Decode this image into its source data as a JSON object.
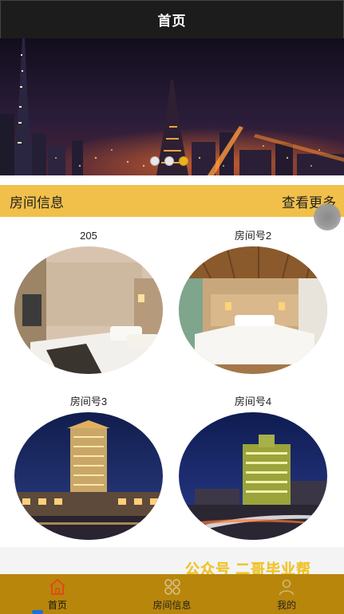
{
  "header": {
    "title": "首页"
  },
  "banner": {
    "slides": 3,
    "active_index": 2,
    "colors": {
      "dot_active": "#e8b320",
      "dot_inactive": "#e8e8e8"
    }
  },
  "section": {
    "title": "房间信息",
    "more_label": "查看更多"
  },
  "rooms": [
    {
      "name": "205"
    },
    {
      "name": "房间号2"
    },
    {
      "name": "房间号3"
    },
    {
      "name": "房间号4"
    }
  ],
  "watermark": "公众号 二哥毕业帮",
  "tabbar": {
    "items": [
      {
        "label": "首页",
        "icon": "home-icon",
        "active": true
      },
      {
        "label": "房间信息",
        "icon": "grid-icon",
        "active": false
      },
      {
        "label": "我的",
        "icon": "user-icon",
        "active": false
      }
    ],
    "colors": {
      "background": "#b8860b",
      "active_icon": "#e04a1a"
    }
  },
  "colors": {
    "accent": "#f1c04a",
    "navbar": "#1c1c1c"
  }
}
